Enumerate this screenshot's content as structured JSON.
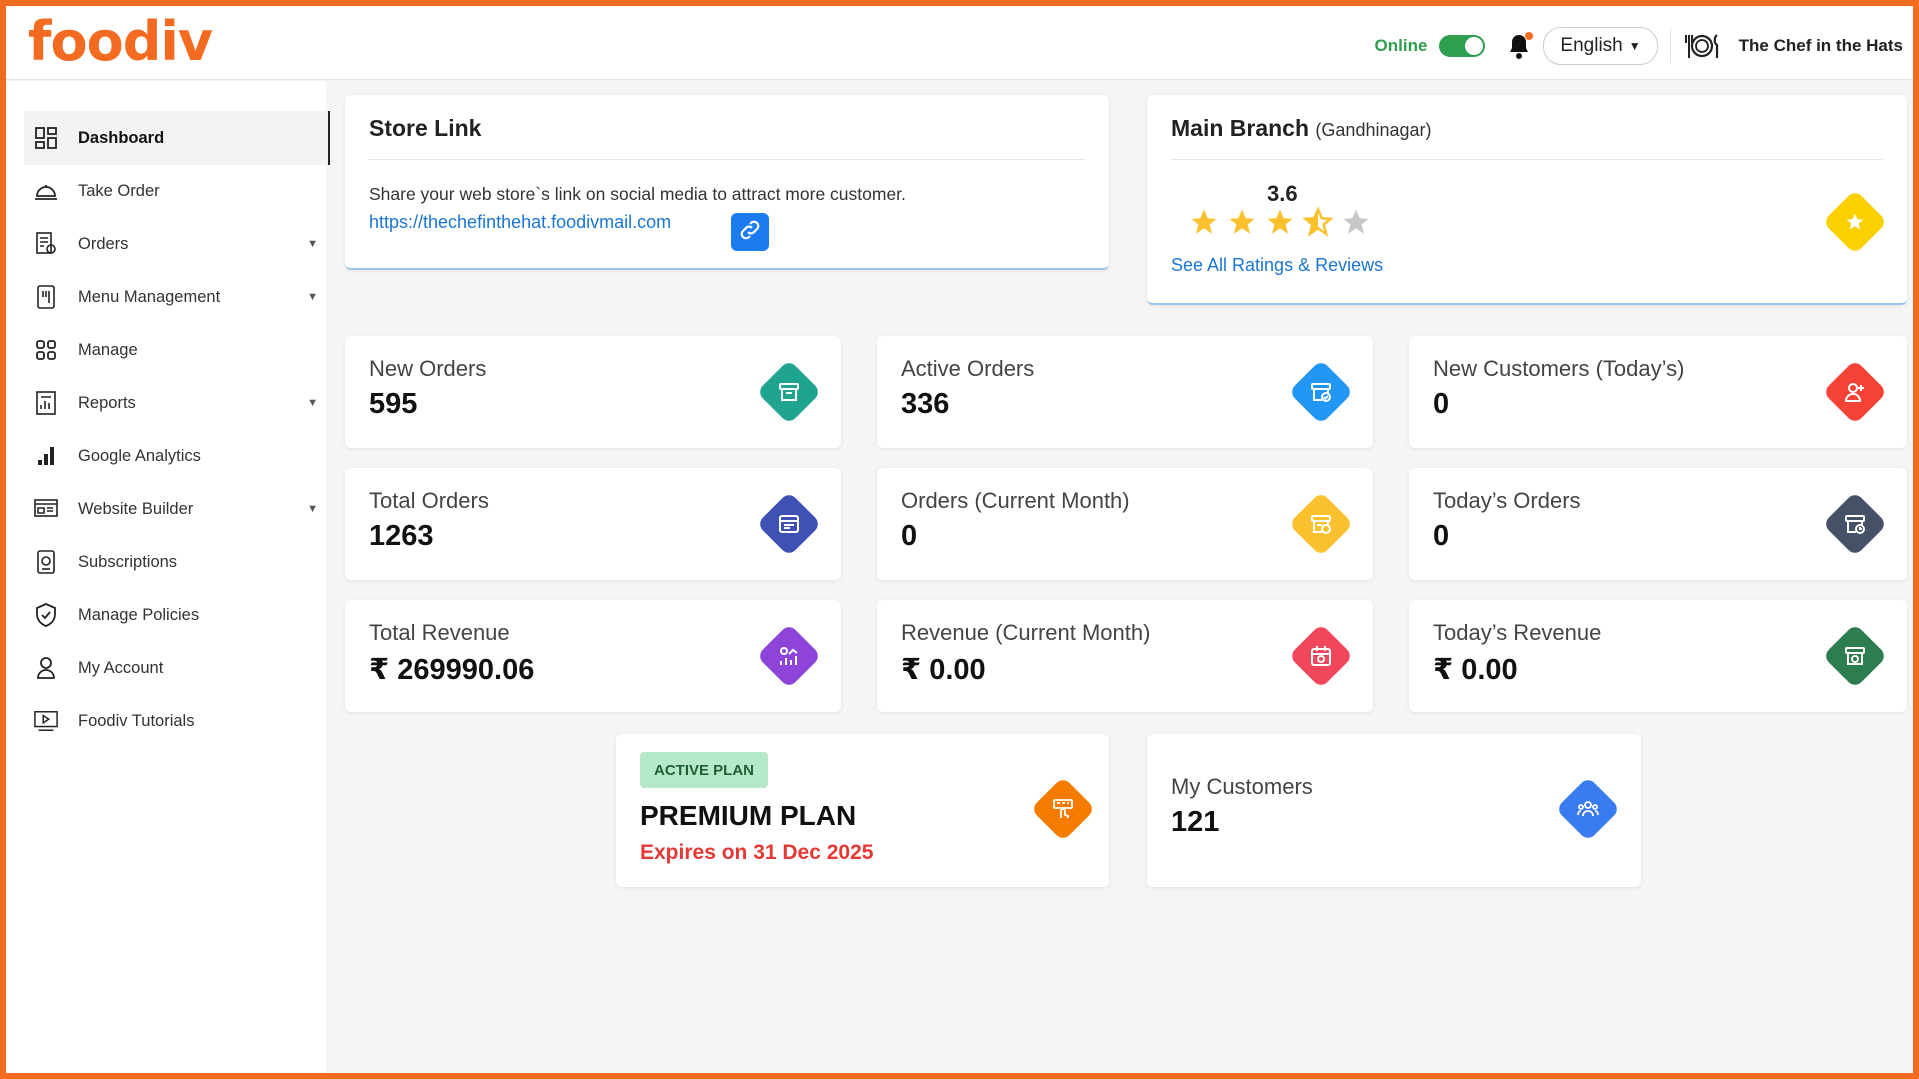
{
  "header": {
    "logo": "foodiv",
    "online_label": "Online",
    "language": "English",
    "restaurant_name": "The Chef in the Hats"
  },
  "sidebar": {
    "items": [
      {
        "label": "Dashboard",
        "icon": "dashboard-icon",
        "active": true
      },
      {
        "label": "Take Order",
        "icon": "cloche-icon"
      },
      {
        "label": "Orders",
        "icon": "orders-icon",
        "has_submenu": true
      },
      {
        "label": "Menu Management",
        "icon": "menu-icon",
        "has_submenu": true
      },
      {
        "label": "Manage",
        "icon": "grid-icon"
      },
      {
        "label": "Reports",
        "icon": "reports-icon",
        "has_submenu": true
      },
      {
        "label": "Google Analytics",
        "icon": "analytics-icon"
      },
      {
        "label": "Website Builder",
        "icon": "website-icon",
        "has_submenu": true
      },
      {
        "label": "Subscriptions",
        "icon": "subscription-icon"
      },
      {
        "label": "Manage Policies",
        "icon": "shield-icon"
      },
      {
        "label": "My Account",
        "icon": "user-icon"
      },
      {
        "label": "Foodiv Tutorials",
        "icon": "video-icon"
      }
    ]
  },
  "store_link": {
    "title": "Store Link",
    "description": "Share your web store`s link on social media to attract more customer.",
    "url": "https://thechefinthehat.foodivmail.com"
  },
  "branch": {
    "title": "Main Branch",
    "location": "(Gandhinagar)",
    "rating": "3.6",
    "rating_value": 3.6,
    "see_all": "See All Ratings & Reviews"
  },
  "stats": [
    {
      "label": "New Orders",
      "value": "595",
      "color": "#1fa58f",
      "icon": "box-icon"
    },
    {
      "label": "Active Orders",
      "value": "336",
      "color": "#2196f3",
      "icon": "box-check-icon"
    },
    {
      "label": "New Customers (Today’s)",
      "value": "0",
      "color": "#f44336",
      "icon": "user-add-icon"
    },
    {
      "label": "Total Orders",
      "value": "1263",
      "color": "#3f51b5",
      "icon": "box-list-icon"
    },
    {
      "label": "Orders (Current Month)",
      "value": "0",
      "color": "#fbc02d",
      "icon": "box-calendar-icon"
    },
    {
      "label": "Today’s Orders",
      "value": "0",
      "color": "#455166",
      "icon": "box-clock-icon"
    },
    {
      "label": "Total Revenue",
      "value": "₹ 269990.06",
      "color": "#8e44d9",
      "icon": "revenue-chart-icon"
    },
    {
      "label": "Revenue (Current Month)",
      "value": "₹ 0.00",
      "color": "#f0475d",
      "icon": "calendar-money-icon"
    },
    {
      "label": "Today’s Revenue",
      "value": "₹ 0.00",
      "color": "#2e7d4f",
      "icon": "box-money-icon"
    }
  ],
  "plan": {
    "badge": "ACTIVE PLAN",
    "name": "PREMIUM PLAN",
    "expiry": "Expires on 31 Dec 2025",
    "color": "#f57c00"
  },
  "customers": {
    "label": "My Customers",
    "value": "121",
    "color": "#3b7bf0"
  },
  "colors": {
    "brand": "#f26b21",
    "online": "#2e9e4f",
    "link": "#1b76d2",
    "star": "#fbc02d",
    "rating_diamond": "#fbd000"
  }
}
